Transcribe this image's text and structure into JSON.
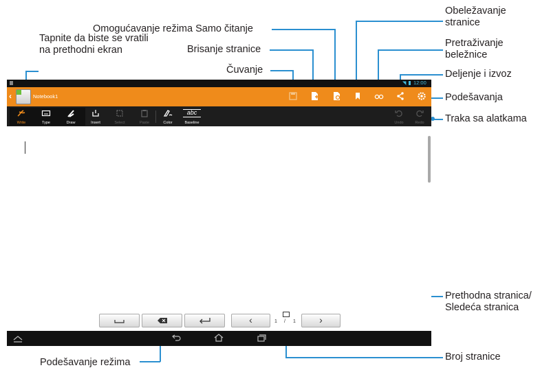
{
  "app": {
    "status_time": "12:00",
    "notebook_title": "Notebook1"
  },
  "toolbar": {
    "tools": [
      {
        "label": "Write",
        "icon": "write-icon"
      },
      {
        "label": "Type",
        "icon": "keyboard-icon"
      },
      {
        "label": "Draw",
        "icon": "brush-icon"
      },
      {
        "label": "Insert",
        "icon": "insert-icon"
      },
      {
        "label": "Select",
        "icon": "select-icon"
      },
      {
        "label": "Paste",
        "icon": "paste-icon"
      },
      {
        "label": "Color",
        "icon": "color-icon"
      },
      {
        "label": "Baseline",
        "icon": "baseline-icon"
      }
    ],
    "undo_label": "Undo",
    "redo_label": "Redo",
    "baseline_sample": "abc"
  },
  "page_nav": {
    "page_current": "1",
    "page_separator": "/",
    "page_total": "1",
    "prev_glyph": "‹",
    "next_glyph": "›"
  },
  "callouts": {
    "back": "Tapnite da biste se vratili\nna prethodni ekran",
    "readonly": "Omogućavanje režima Samo čitanje",
    "delete_page": "Brisanje stranice",
    "save": "Čuvanje",
    "bookmark": "Obeležavanje\nstranice",
    "search": "Pretraživanje\nbeležnice",
    "share": "Deljenje i izvoz",
    "settings": "Podešavanja",
    "toolbar": "Traka sa alatkama",
    "prev_next": "Prethodna stranica/\nSledeća stranica",
    "page_number": "Broj stranice",
    "mode_settings": "Podešavanje režima"
  },
  "colors": {
    "accent": "#ef8b1b",
    "callout_line": "#2a8fd0",
    "toolbar_bg": "#1d1d1d"
  }
}
